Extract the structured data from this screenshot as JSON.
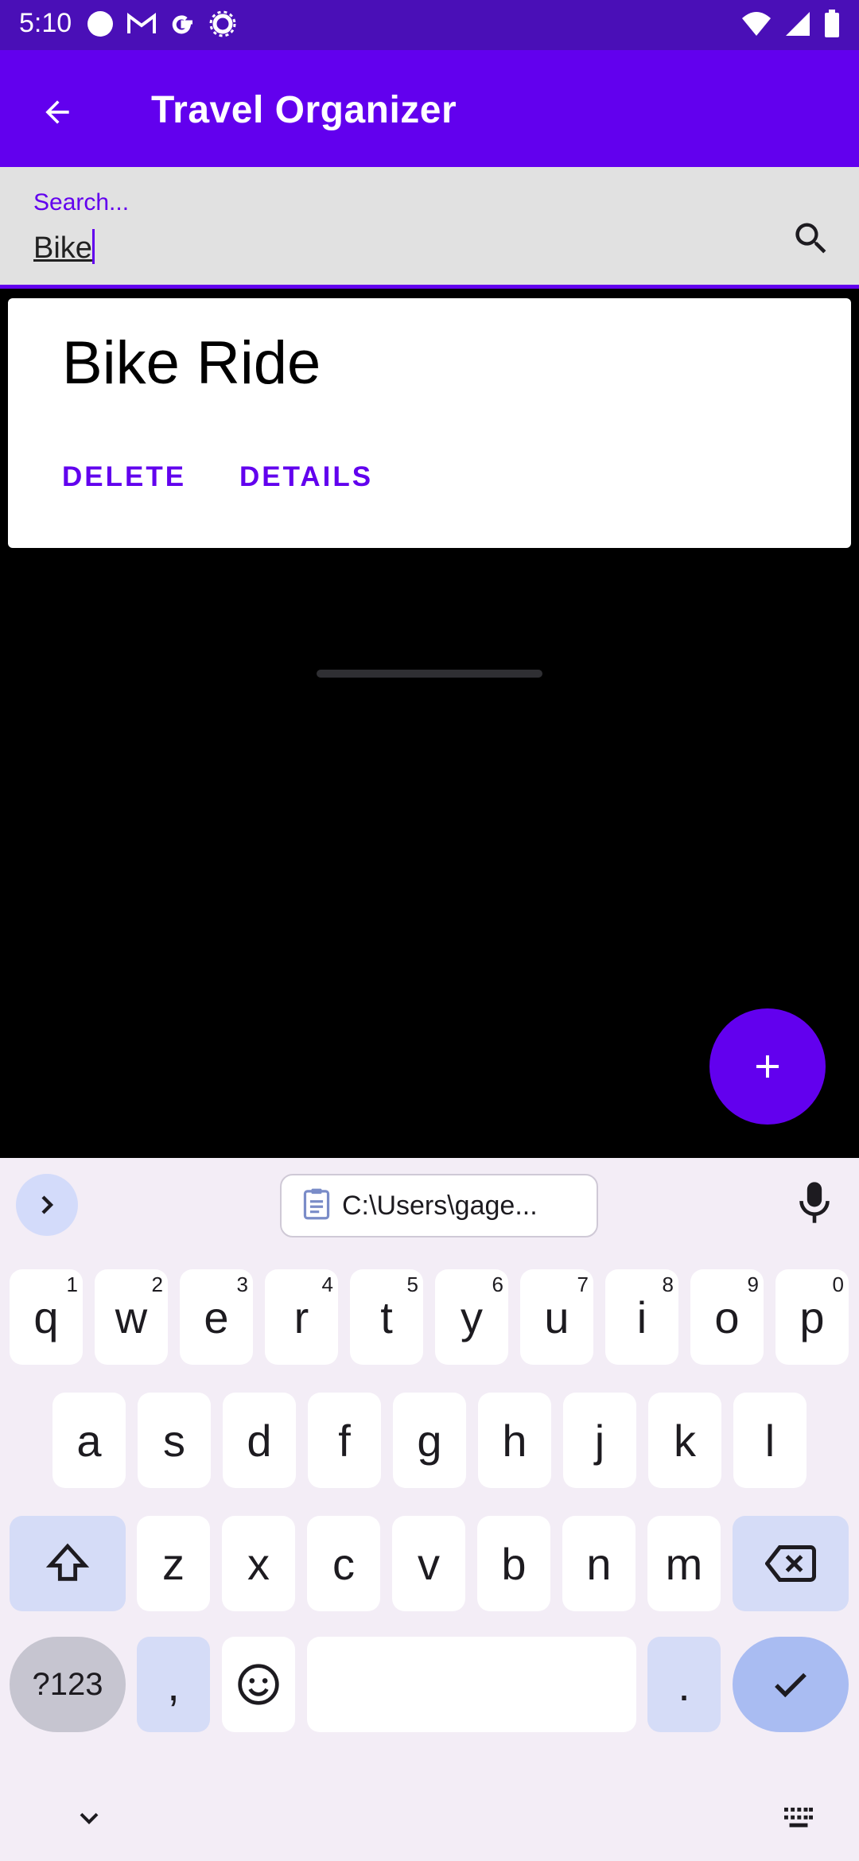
{
  "status_bar": {
    "time": "5:10"
  },
  "app_bar": {
    "title": "Travel Organizer"
  },
  "search": {
    "label": "Search...",
    "value": "Bike"
  },
  "card": {
    "name": "Bike Ride",
    "delete_label": "DELETE",
    "details_label": "DETAILS"
  },
  "colors": {
    "primary": "#6200ee",
    "status_bar": "#4a0fb7",
    "keyboard_bg": "#f3edf6"
  },
  "keyboard": {
    "clipboard": "C:\\Users\\gage...",
    "row1": [
      {
        "k": "q",
        "n": "1"
      },
      {
        "k": "w",
        "n": "2"
      },
      {
        "k": "e",
        "n": "3"
      },
      {
        "k": "r",
        "n": "4"
      },
      {
        "k": "t",
        "n": "5"
      },
      {
        "k": "y",
        "n": "6"
      },
      {
        "k": "u",
        "n": "7"
      },
      {
        "k": "i",
        "n": "8"
      },
      {
        "k": "o",
        "n": "9"
      },
      {
        "k": "p",
        "n": "0"
      }
    ],
    "row2": [
      "a",
      "s",
      "d",
      "f",
      "g",
      "h",
      "j",
      "k",
      "l"
    ],
    "row3": [
      "z",
      "x",
      "c",
      "v",
      "b",
      "n",
      "m"
    ],
    "symbols": "?123",
    "comma": ",",
    "period": "."
  }
}
